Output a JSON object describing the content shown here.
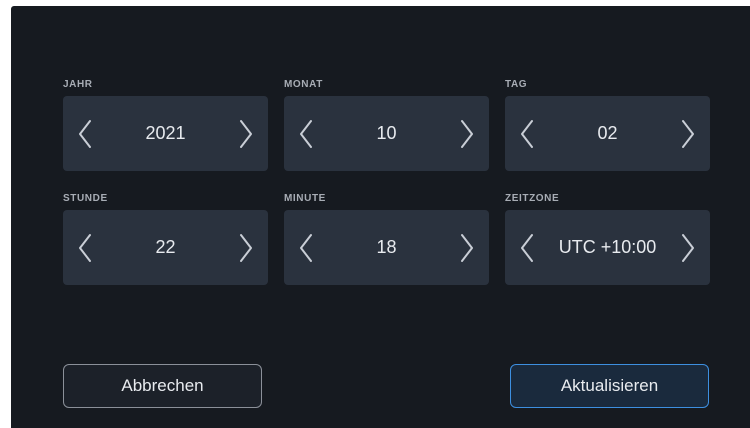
{
  "fields": [
    {
      "label": "JAHR",
      "value": "2021"
    },
    {
      "label": "MONAT",
      "value": "10"
    },
    {
      "label": "TAG",
      "value": "02"
    },
    {
      "label": "STUNDE",
      "value": "22"
    },
    {
      "label": "MINUTE",
      "value": "18"
    },
    {
      "label": "ZEITZONE",
      "value": "UTC +10:00"
    }
  ],
  "buttons": {
    "cancel_label": "Abbrechen",
    "update_label": "Aktualisieren"
  },
  "colors": {
    "background": "#161a20",
    "stepper": "#2a323e",
    "accent": "#3d8fe0",
    "text": "#e8ebef",
    "label": "#a8adb5"
  }
}
